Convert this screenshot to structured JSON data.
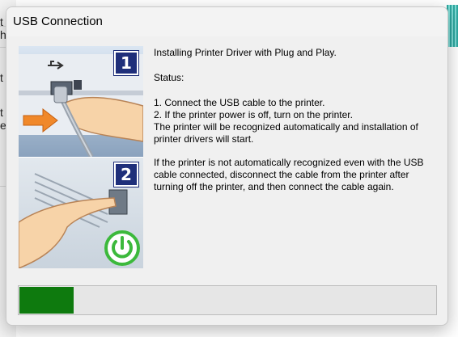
{
  "dialog": {
    "title": "USB Connection",
    "heading": "Installing Printer Driver with Plug and Play.",
    "status_label": "Status:",
    "status_lines": [
      "1. Connect the USB cable to the printer.",
      "2. If the printer power is off, turn on the printer.",
      "The printer will be recognized automatically and installation of printer drivers will start."
    ],
    "note": "If the printer is not automatically recognized even with the USB cable connected, disconnect the cable from the printer after turning off the printer, and then connect the cable again."
  },
  "illustration": {
    "step_1_number": "1",
    "step_2_number": "2",
    "step_1_icon": "usb-cable-icon",
    "step_2_icon": "power-button-icon"
  },
  "progress": {
    "fraction": 0.13,
    "fill_color": "#0e7a0e"
  },
  "background_window": {
    "visible_chars": [
      "t",
      "h",
      "t",
      "t",
      "e"
    ]
  },
  "colors": {
    "dialog_bg": "#f0f0f0",
    "badge": "#1f2f7a",
    "power_icon": "#3cb93c"
  }
}
